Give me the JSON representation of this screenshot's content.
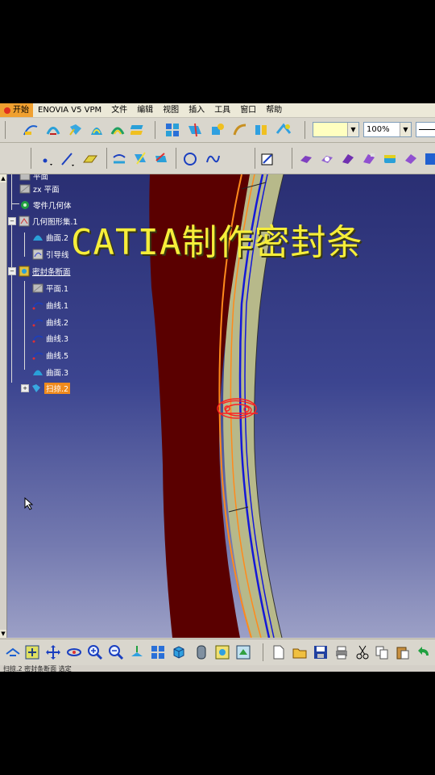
{
  "menu": [
    "开始",
    "ENOVIA V5 VPM",
    "文件",
    "编辑",
    "视图",
    "插入",
    "工具",
    "窗口",
    "帮助"
  ],
  "toolbar": {
    "color_value": "",
    "zoom_value": "100%"
  },
  "tree": {
    "top_partial": "平面",
    "zx_plane": "zx 平面",
    "part_body": "零件几何体",
    "geo_set_1": "几何图形集.1",
    "surface_2": "曲面.2",
    "guide_line": "引导线",
    "seal_section": "密封条断面",
    "plane_1": "平面.1",
    "curve_1": "曲线.1",
    "curve_2": "曲线.2",
    "curve_3": "曲线.3",
    "curve_5": "曲线.5",
    "surface_3": "曲面.3",
    "sweep_2": "扫掠.2"
  },
  "overlay_title": "CATIA制作密封条",
  "status": "扫掠.2 密封条断面 选定",
  "colors": {
    "body": "#5a0000",
    "strip": "#b7b98a",
    "edge_orange": "#ff8a1c",
    "edge_blue": "#1418d8",
    "section_red": "#ff2020",
    "selection": "#f08a1c"
  }
}
